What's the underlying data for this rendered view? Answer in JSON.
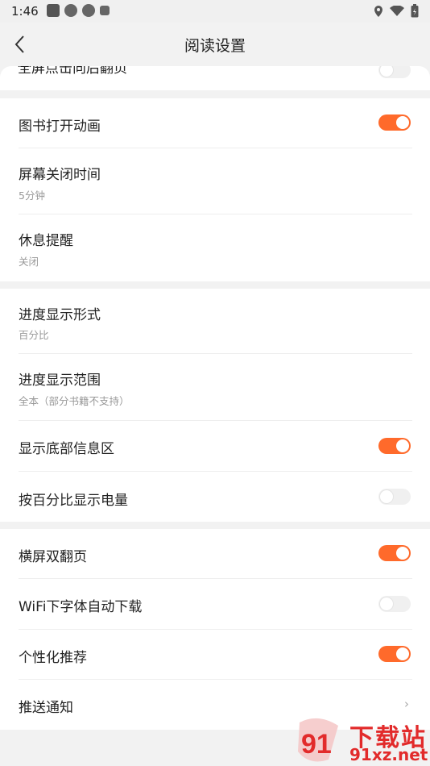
{
  "status_bar": {
    "time": "1:46",
    "left_icons": [
      "app-square-icon",
      "settings-gear-icon",
      "settings-gear-icon",
      "a-notification-icon"
    ],
    "right_icons": [
      "location-icon",
      "wifi-icon",
      "battery-icon"
    ]
  },
  "header": {
    "title": "阅读设置",
    "back_icon": "back-chevron-icon"
  },
  "colors": {
    "accent": "#ff6a2b",
    "background": "#f2f2f2",
    "card": "#ffffff",
    "subtext": "#999999"
  },
  "peek_item": {
    "label": "全屏点击向后翻页",
    "toggle_on": false
  },
  "sections": [
    {
      "items": [
        {
          "label": "图书打开动画",
          "type": "toggle",
          "on": true
        },
        {
          "label": "屏幕关闭时间",
          "type": "value",
          "value": "5分钟"
        },
        {
          "label": "休息提醒",
          "type": "value",
          "value": "关闭"
        }
      ]
    },
    {
      "items": [
        {
          "label": "进度显示形式",
          "type": "value",
          "value": "百分比"
        },
        {
          "label": "进度显示范围",
          "type": "value",
          "value": "全本（部分书籍不支持）"
        },
        {
          "label": "显示底部信息区",
          "type": "toggle",
          "on": true
        },
        {
          "label": "按百分比显示电量",
          "type": "toggle",
          "on": false
        }
      ]
    },
    {
      "items": [
        {
          "label": "横屏双翻页",
          "type": "toggle",
          "on": true
        },
        {
          "label": "WiFi下字体自动下载",
          "type": "toggle",
          "on": false
        },
        {
          "label": "个性化推荐",
          "type": "toggle",
          "on": true
        },
        {
          "label": "推送通知",
          "type": "link",
          "icon": "chevron-right-icon"
        }
      ]
    }
  ],
  "watermark": {
    "main": "下载站",
    "sub": "91xz.net",
    "logo_text": "91"
  }
}
